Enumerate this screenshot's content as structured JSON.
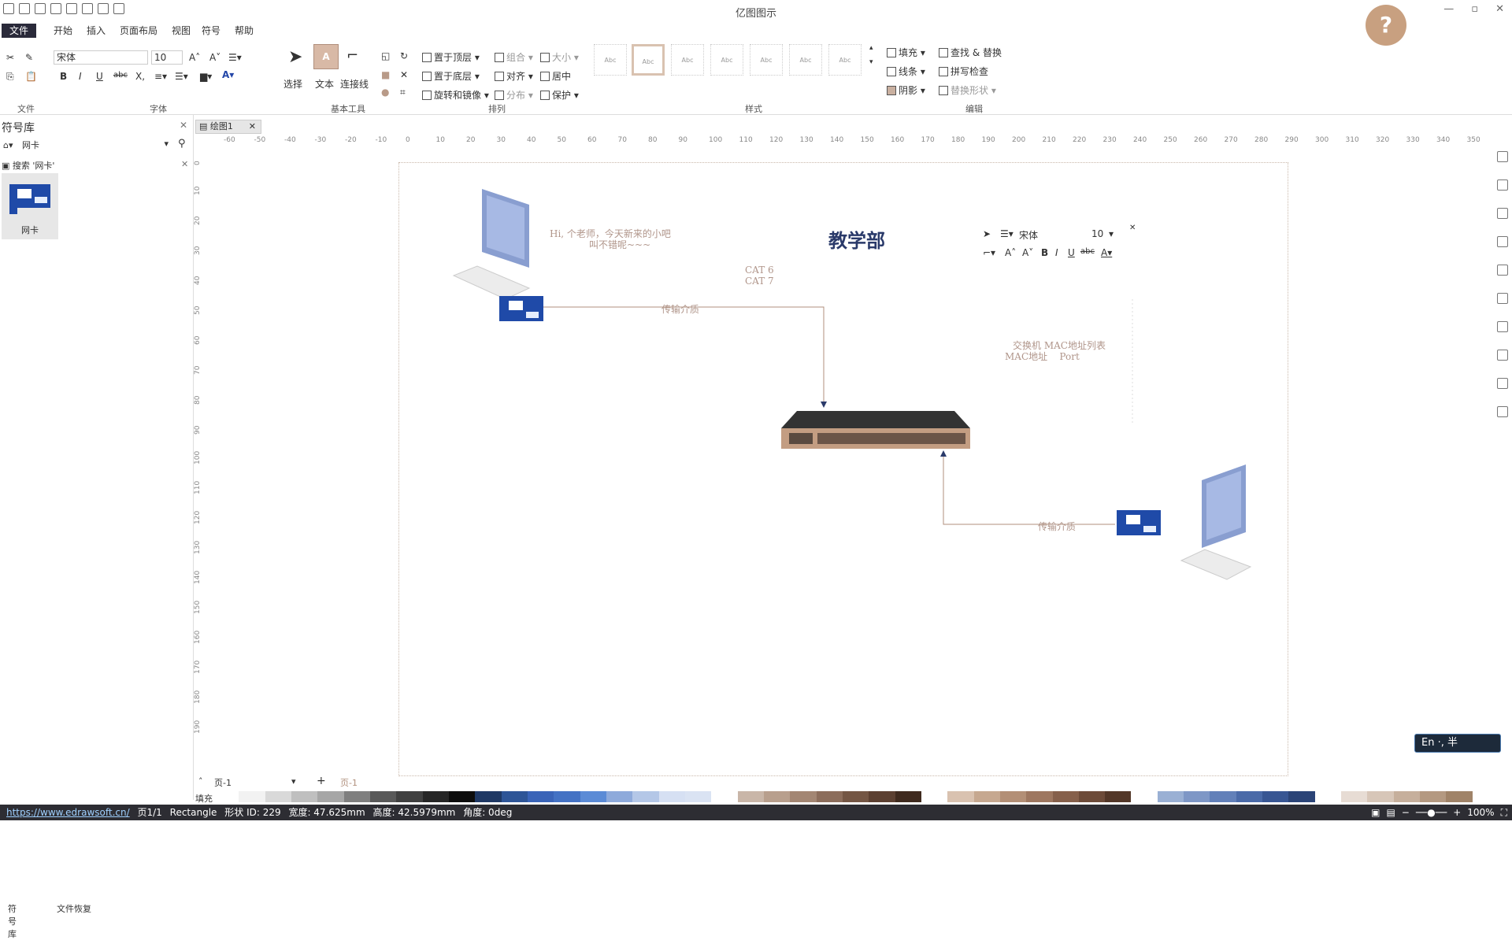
{
  "app": {
    "title": "亿图图示",
    "window_controls": [
      "—",
      "▫",
      "✕"
    ]
  },
  "menu": {
    "tabs": [
      "文件",
      "开始",
      "插入",
      "页面布局",
      "视图",
      "符号",
      "帮助"
    ],
    "active": "文件"
  },
  "ribbon": {
    "font_name": "宋体",
    "font_size": "10",
    "groups": [
      "文件",
      "字体",
      "基本工具",
      "排列",
      "样式",
      "编辑"
    ],
    "tools": {
      "select": "选择",
      "text": "文本",
      "connector": "连接线"
    },
    "arrange": {
      "bring_front": "置于顶层",
      "send_back": "置于底层",
      "rotate": "旋转和镜像",
      "group": "组合",
      "align": "对齐",
      "distribute": "分布",
      "size": "大小",
      "center": "居中",
      "protect": "保护"
    },
    "style": {
      "fill": "填充",
      "line": "线条",
      "shadow": "阴影"
    },
    "edit": {
      "find_replace": "查找 & 替换",
      "spell": "拼写检查",
      "replace_shape": "替换形状"
    },
    "style_boxes": [
      "Abc",
      "Abc",
      "Abc",
      "Abc",
      "Abc",
      "Abc",
      "Abc"
    ]
  },
  "left_panel": {
    "title": "符号库",
    "library": "网卡",
    "search_label": "搜索 '网卡'",
    "items": [
      {
        "label": "网卡"
      }
    ],
    "bottom_tabs": [
      "符号库",
      "文件恢复"
    ]
  },
  "document": {
    "tab": "绘图1",
    "page_tab": "页-1",
    "page_tab2": "页-1"
  },
  "rulers": {
    "h": [
      "-60",
      "-50",
      "-40",
      "-30",
      "-20",
      "-10",
      "0",
      "10",
      "20",
      "30",
      "40",
      "50",
      "60",
      "70",
      "80",
      "90",
      "100",
      "110",
      "120",
      "130",
      "140",
      "150",
      "160",
      "170",
      "180",
      "190",
      "200",
      "210",
      "220",
      "230",
      "240",
      "250",
      "260",
      "270",
      "280",
      "290",
      "300",
      "310",
      "320",
      "330",
      "340",
      "350"
    ],
    "v": [
      "0",
      "10",
      "20",
      "30",
      "40",
      "50",
      "60",
      "70",
      "80",
      "90",
      "100",
      "110",
      "120",
      "130",
      "140",
      "150",
      "160",
      "170",
      "180",
      "190"
    ]
  },
  "diagram": {
    "title": "教学部",
    "speech_line1": "Hi, 个老师，今天新来的小吧",
    "speech_line2": "叫不错呢~~~",
    "cable1": "CAT 6",
    "cable2": "CAT 7",
    "link1_label": "传输介质",
    "link2_label": "传输介质",
    "mac_table_title": "交换机 MAC地址列表",
    "mac_table_header": "MAC地址    Port    ",
    "float_font": "宋体",
    "float_size": "10"
  },
  "palette": [
    "#ffffff",
    "#f2f2f2",
    "#d9d9d9",
    "#bfbfbf",
    "#a6a6a6",
    "#7f7f7f",
    "#595959",
    "#404040",
    "#262626",
    "#0d0d0d",
    "#1f3864",
    "#2e5597",
    "#3a64b8",
    "#4472c4",
    "#5b8bd6",
    "#8eaadb",
    "#b4c7e7",
    "#d6e0f3",
    "#dae3f3",
    "#ffffff",
    "#c9b6a8",
    "#b89f8d",
    "#a38673",
    "#8c6d5b",
    "#745644",
    "#5c4031",
    "#3f2a1e",
    "#ffffff",
    "#d9c2b0",
    "#c6a890",
    "#b38f76",
    "#9e7760",
    "#86604b",
    "#6d4b39",
    "#533728",
    "#ffffff",
    "#9ab0d4",
    "#7e97c6",
    "#6280b9",
    "#4a6aa8",
    "#385693",
    "#2b4477",
    "#ffffff",
    "#e7dcd4",
    "#d7c6b8",
    "#c6af9c",
    "#b49981",
    "#a08368"
  ],
  "status": {
    "url": "https://www.edrawsoft.cn/",
    "page": "页1/1",
    "shape": "Rectangle",
    "shape_id": "形状 ID: 229",
    "width": "宽度: 47.625mm",
    "height": "高度: 42.5979mm",
    "angle": "角度: 0deg",
    "zoom": "100%"
  },
  "ime": "En ·, 半"
}
